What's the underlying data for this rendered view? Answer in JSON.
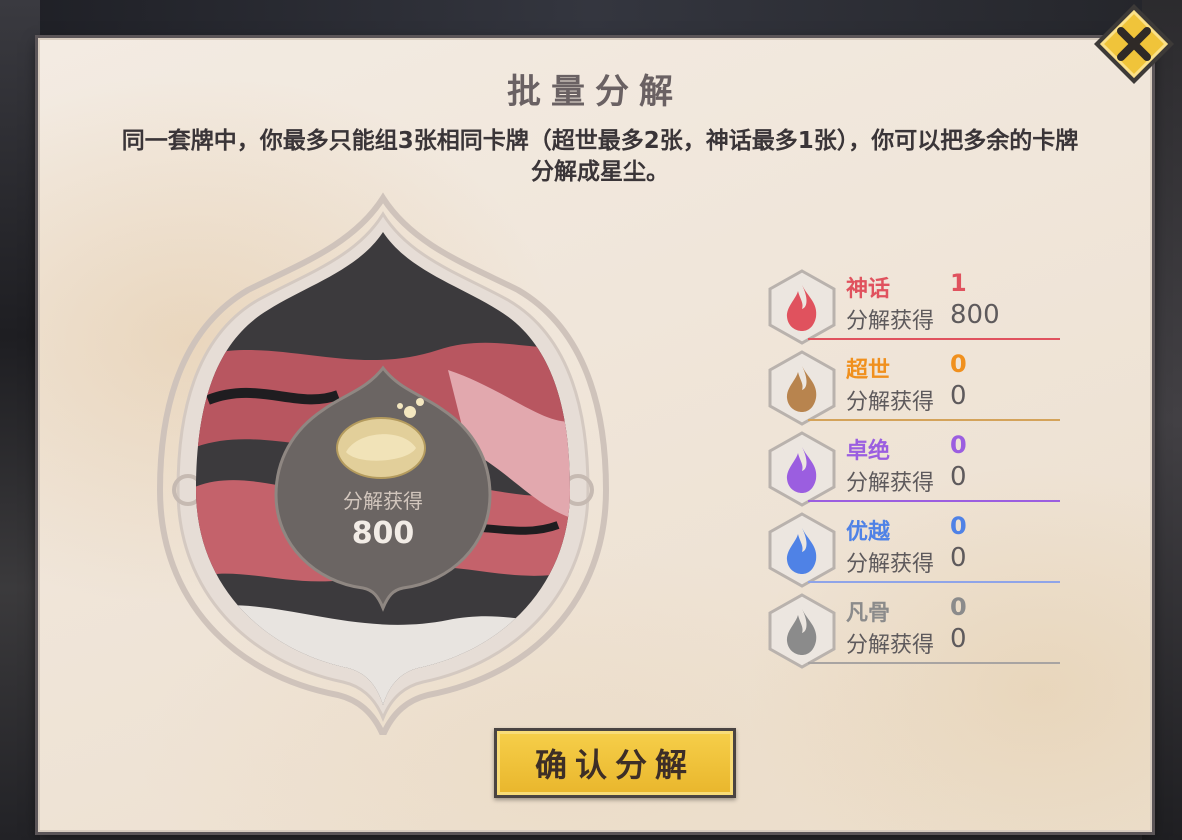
{
  "dialog": {
    "title": "批量分解",
    "description": "同一套牌中，你最多只能组3张相同卡牌（超世最多2张，神话最多1张），你可以把多余的卡牌分解成星尘。"
  },
  "summary": {
    "label": "分解获得",
    "value": "800"
  },
  "rarities": [
    {
      "name": "神话",
      "count": "1",
      "gain_label": "分解获得",
      "gain_value": "800",
      "color": "#e0525e",
      "icon": "flame-icon"
    },
    {
      "name": "超世",
      "count": "0",
      "gain_label": "分解获得",
      "gain_value": "0",
      "color": "#f0901e",
      "icon": "flame-icon"
    },
    {
      "name": "卓绝",
      "count": "0",
      "gain_label": "分解获得",
      "gain_value": "0",
      "color": "#9b5ee0",
      "icon": "flame-icon"
    },
    {
      "name": "优越",
      "count": "0",
      "gain_label": "分解获得",
      "gain_value": "0",
      "color": "#4f82e6",
      "icon": "flame-icon"
    },
    {
      "name": "凡骨",
      "count": "0",
      "gain_label": "分解获得",
      "gain_value": "0",
      "color": "#8b8b8b",
      "icon": "flame-icon"
    }
  ],
  "confirm_button": {
    "label": "确认分解"
  },
  "close_button": {
    "icon": "close-icon"
  }
}
